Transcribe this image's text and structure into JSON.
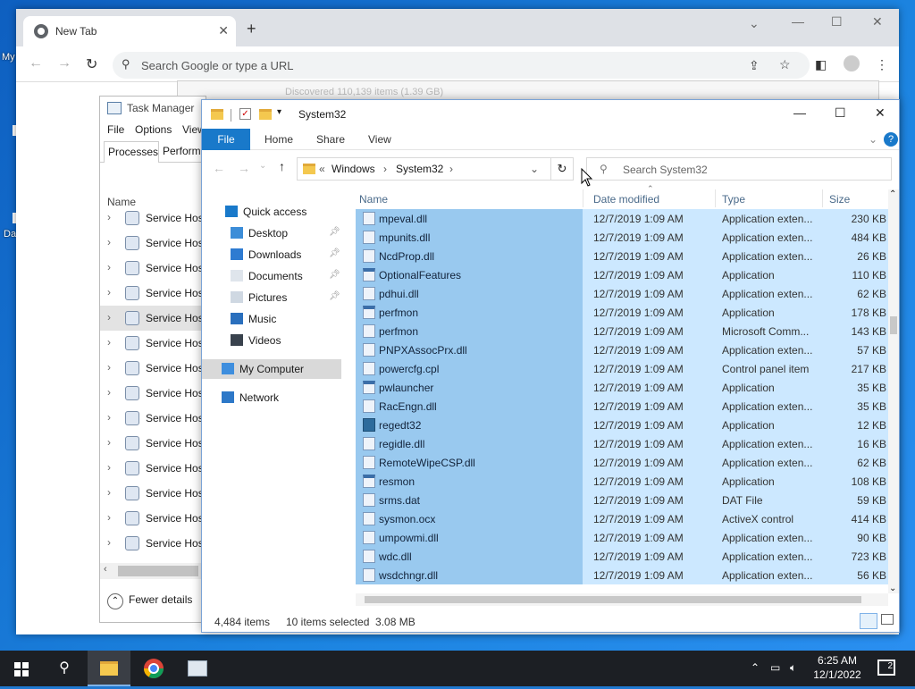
{
  "desktop": {
    "label_1": "My",
    "label_2": "Da"
  },
  "chrome": {
    "tab_title": "New Tab",
    "omnibox_placeholder": "Search Google or type a URL"
  },
  "ghost_window": {
    "text": "Discovered 110,139 items (1.39 GB)"
  },
  "task_manager": {
    "title": "Task Manager",
    "menu": [
      "File",
      "Options",
      "View"
    ],
    "tabs": [
      "Processes",
      "Perform"
    ],
    "column_name": "Name",
    "rows": [
      "Service Host",
      "Service Host",
      "Service Host",
      "Service Host",
      "Service Host",
      "Service Host",
      "Service Host",
      "Service Host",
      "Service Host",
      "Service Host",
      "Service Host",
      "Service Host",
      "Service Host",
      "Service Host"
    ],
    "fewer_details": "Fewer details"
  },
  "explorer": {
    "title": "System32",
    "ribbon": {
      "file": "File",
      "home": "Home",
      "share": "Share",
      "view": "View"
    },
    "address": {
      "prefix": "«",
      "crumb1": "Windows",
      "crumb2": "System32"
    },
    "search_placeholder": "Search System32",
    "nav": [
      {
        "label": "Quick access",
        "pinned": false
      },
      {
        "label": "Desktop",
        "pinned": true
      },
      {
        "label": "Downloads",
        "pinned": true
      },
      {
        "label": "Documents",
        "pinned": true
      },
      {
        "label": "Pictures",
        "pinned": true
      },
      {
        "label": "Music",
        "pinned": false
      },
      {
        "label": "Videos",
        "pinned": false
      },
      {
        "label": "My Computer",
        "pinned": false
      },
      {
        "label": "Network",
        "pinned": false
      }
    ],
    "columns": {
      "name": "Name",
      "date": "Date modified",
      "type": "Type",
      "size": "Size"
    },
    "files": [
      {
        "name": "mpeval.dll",
        "date": "12/7/2019 1:09 AM",
        "type": "Application exten...",
        "size": "230 KB",
        "icon": "dll"
      },
      {
        "name": "mpunits.dll",
        "date": "12/7/2019 1:09 AM",
        "type": "Application exten...",
        "size": "484 KB",
        "icon": "dll"
      },
      {
        "name": "NcdProp.dll",
        "date": "12/7/2019 1:09 AM",
        "type": "Application exten...",
        "size": "26 KB",
        "icon": "dll"
      },
      {
        "name": "OptionalFeatures",
        "date": "12/7/2019 1:09 AM",
        "type": "Application",
        "size": "110 KB",
        "icon": "app"
      },
      {
        "name": "pdhui.dll",
        "date": "12/7/2019 1:09 AM",
        "type": "Application exten...",
        "size": "62 KB",
        "icon": "dll"
      },
      {
        "name": "perfmon",
        "date": "12/7/2019 1:09 AM",
        "type": "Application",
        "size": "178 KB",
        "icon": "app"
      },
      {
        "name": "perfmon",
        "date": "12/7/2019 1:09 AM",
        "type": "Microsoft Comm...",
        "size": "143 KB",
        "icon": "doc"
      },
      {
        "name": "PNPXAssocPrx.dll",
        "date": "12/7/2019 1:09 AM",
        "type": "Application exten...",
        "size": "57 KB",
        "icon": "dll"
      },
      {
        "name": "powercfg.cpl",
        "date": "12/7/2019 1:09 AM",
        "type": "Control panel item",
        "size": "217 KB",
        "icon": "dll"
      },
      {
        "name": "pwlauncher",
        "date": "12/7/2019 1:09 AM",
        "type": "Application",
        "size": "35 KB",
        "icon": "app"
      },
      {
        "name": "RacEngn.dll",
        "date": "12/7/2019 1:09 AM",
        "type": "Application exten...",
        "size": "35 KB",
        "icon": "dll"
      },
      {
        "name": "regedt32",
        "date": "12/7/2019 1:09 AM",
        "type": "Application",
        "size": "12 KB",
        "icon": "reg"
      },
      {
        "name": "regidle.dll",
        "date": "12/7/2019 1:09 AM",
        "type": "Application exten...",
        "size": "16 KB",
        "icon": "dll"
      },
      {
        "name": "RemoteWipeCSP.dll",
        "date": "12/7/2019 1:09 AM",
        "type": "Application exten...",
        "size": "62 KB",
        "icon": "dll"
      },
      {
        "name": "resmon",
        "date": "12/7/2019 1:09 AM",
        "type": "Application",
        "size": "108 KB",
        "icon": "app"
      },
      {
        "name": "srms.dat",
        "date": "12/7/2019 1:09 AM",
        "type": "DAT File",
        "size": "59 KB",
        "icon": "doc"
      },
      {
        "name": "sysmon.ocx",
        "date": "12/7/2019 1:09 AM",
        "type": "ActiveX control",
        "size": "414 KB",
        "icon": "dll"
      },
      {
        "name": "umpowmi.dll",
        "date": "12/7/2019 1:09 AM",
        "type": "Application exten...",
        "size": "90 KB",
        "icon": "dll"
      },
      {
        "name": "wdc.dll",
        "date": "12/7/2019 1:09 AM",
        "type": "Application exten...",
        "size": "723 KB",
        "icon": "dll"
      },
      {
        "name": "wsdchngr.dll",
        "date": "12/7/2019 1:09 AM",
        "type": "Application exten...",
        "size": "56 KB",
        "icon": "dll"
      }
    ],
    "status": {
      "items": "4,484 items",
      "selected": "10 items selected  3.08 MB"
    }
  },
  "taskbar": {
    "time": "6:25 AM",
    "date": "12/1/2022",
    "notifications": "2"
  },
  "colors": {
    "selection": "#cce8ff",
    "selection_name": "#99c9ef",
    "accent": "#1979ca"
  }
}
